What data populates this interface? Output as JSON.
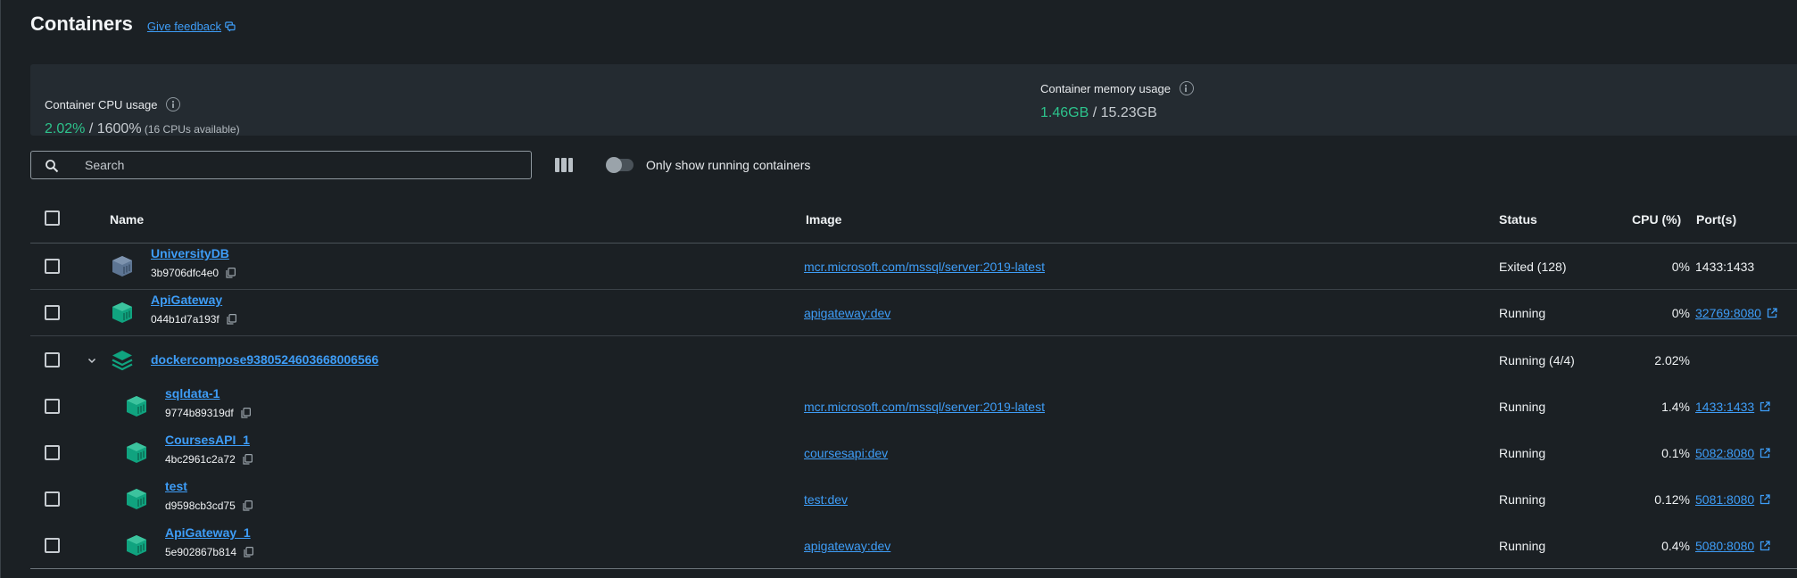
{
  "header": {
    "title": "Containers",
    "feedback_label": "Give feedback"
  },
  "stats": {
    "cpu": {
      "label": "Container CPU usage",
      "used": "2.02%",
      "sep": " / ",
      "total": "1600%",
      "note": " (16 CPUs available)"
    },
    "memory": {
      "label": "Container memory usage",
      "used": "1.46GB",
      "sep": " / ",
      "total": "15.23GB"
    }
  },
  "search": {
    "placeholder": "Search"
  },
  "toggle": {
    "label": "Only show running containers",
    "checked": false
  },
  "columns": {
    "name": "Name",
    "image": "Image",
    "status": "Status",
    "cpu": "CPU (%)",
    "ports": "Port(s)"
  },
  "rows": [
    {
      "name": "UniversityDB",
      "id": "3b9706dfc4e0",
      "image": "mcr.microsoft.com/mssql/server:2019-latest",
      "status": "Exited (128)",
      "cpu": "0%",
      "ports": "1433:1433",
      "ports_link": false,
      "running": false
    },
    {
      "name": "ApiGateway",
      "id": "044b1d7a193f",
      "image": "apigateway:dev",
      "status": "Running",
      "cpu": "0%",
      "ports": "32769:8080",
      "ports_link": true,
      "running": true
    },
    {
      "name": "dockercompose9380524603668006566",
      "status": "Running (4/4)",
      "cpu": "2.02%",
      "group": true
    },
    {
      "name": "sqldata-1",
      "id": "9774b89319df",
      "image": "mcr.microsoft.com/mssql/server:2019-latest",
      "status": "Running",
      "cpu": "1.4%",
      "ports": "1433:1433",
      "ports_link": true,
      "running": true
    },
    {
      "name": "CoursesAPI_1",
      "id": "4bc2961c2a72",
      "image": "coursesapi:dev",
      "status": "Running",
      "cpu": "0.1%",
      "ports": "5082:8080",
      "ports_link": true,
      "running": true
    },
    {
      "name": "test",
      "id": "d9598cb3cd75",
      "image": "test:dev",
      "status": "Running",
      "cpu": "0.12%",
      "ports": "5081:8080",
      "ports_link": true,
      "running": true
    },
    {
      "name": "ApiGateway_1",
      "id": "5e902867b814",
      "image": "apigateway:dev",
      "status": "Running",
      "cpu": "0.4%",
      "ports": "5080:8080",
      "ports_link": true,
      "running": true
    }
  ],
  "icons": {
    "feedback": "feedback-icon",
    "info": "info-icon",
    "search": "search-icon",
    "columns": "columns-icon",
    "container": "container-icon",
    "compose": "stack-icon",
    "copy": "copy-icon",
    "external": "external-link-icon",
    "chevron": "chevron-down-icon"
  },
  "colors": {
    "accent": "#3e9df7",
    "running": "#10a37f",
    "stopped": "#5d7593",
    "green_value": "#2dc38c",
    "background": "#1b2024"
  }
}
